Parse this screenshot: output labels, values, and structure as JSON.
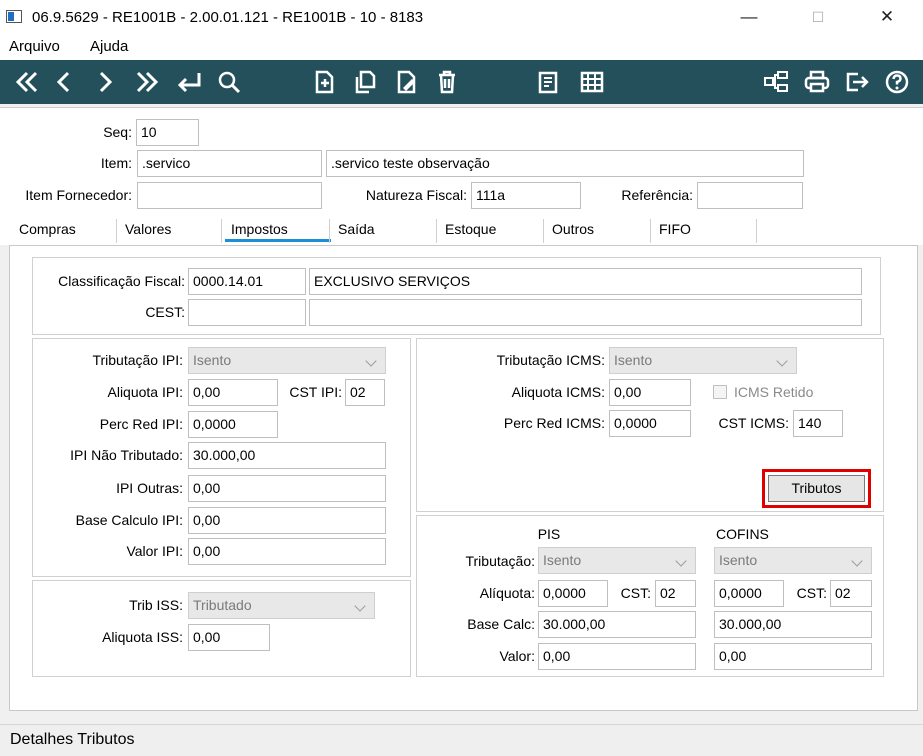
{
  "window": {
    "title": "06.9.5629 - RE1001B - 2.00.01.121 - RE1001B - 10 - 8183",
    "minimize": "—",
    "maximize": "☐",
    "close": "✕"
  },
  "menu": {
    "arquivo": "Arquivo",
    "ajuda": "Ajuda"
  },
  "toolbar": {
    "icons": [
      "first-icon",
      "previous-icon",
      "next-icon",
      "last-icon",
      "return-icon",
      "search-icon",
      "new-document-icon",
      "copy-icon",
      "edit-icon",
      "delete-icon",
      "report-icon",
      "grid-icon",
      "tree-icon",
      "print-icon",
      "exit-icon",
      "help-icon"
    ]
  },
  "header": {
    "seq_label": "Seq:",
    "seq_value": "10",
    "item_label": "Item:",
    "item_code": ".servico",
    "item_desc": ".servico teste observação",
    "item_fornecedor_label": "Item Fornecedor:",
    "item_fornecedor_value": "",
    "natureza_label": "Natureza Fiscal:",
    "natureza_value": "111a",
    "referencia_label": "Referência:",
    "referencia_value": ""
  },
  "tabs": [
    "Compras",
    "Valores",
    "Impostos",
    "Saída",
    "Estoque",
    "Outros",
    "FIFO"
  ],
  "active_tab": "Impostos",
  "accent_color": "#1a8fd6",
  "classificacao": {
    "label": "Classificação Fiscal:",
    "code": "0000.14.01",
    "desc": "EXCLUSIVO SERVIÇOS",
    "cest_label": "CEST:",
    "cest_code": "",
    "cest_desc": ""
  },
  "ipi": {
    "tributacao_label": "Tributação IPI:",
    "tributacao_value": "Isento",
    "aliquota_label": "Aliquota IPI:",
    "aliquota_value": "0,00",
    "cst_label": "CST IPI:",
    "cst_value": "02",
    "perc_red_label": "Perc Red IPI:",
    "perc_red_value": "0,0000",
    "nao_tributado_label": "IPI Não Tributado:",
    "nao_tributado_value": "30.000,00",
    "outras_label": "IPI Outras:",
    "outras_value": "0,00",
    "base_label": "Base Calculo IPI:",
    "base_value": "0,00",
    "valor_label": "Valor IPI:",
    "valor_value": "0,00"
  },
  "iss": {
    "trib_label": "Trib ISS:",
    "trib_value": "Tributado",
    "aliquota_label": "Aliquota ISS:",
    "aliquota_value": "0,00"
  },
  "icms": {
    "tributacao_label": "Tributação ICMS:",
    "tributacao_value": "Isento",
    "aliquota_label": "Aliquota ICMS:",
    "aliquota_value": "0,00",
    "retido_label": "ICMS Retido",
    "perc_red_label": "Perc Red ICMS:",
    "perc_red_value": "0,0000",
    "cst_label": "CST ICMS:",
    "cst_value": "140",
    "tributos_button": "Tributos"
  },
  "pis_cofins": {
    "pis_header": "PIS",
    "cofins_header": "COFINS",
    "tributacao_label": "Tributação:",
    "aliquota_label": "Alíquota:",
    "cst_label": "CST:",
    "base_label": "Base Calc:",
    "valor_label": "Valor:",
    "pis": {
      "tributacao": "Isento",
      "aliquota": "0,0000",
      "cst": "02",
      "base": "30.000,00",
      "valor": "0,00"
    },
    "cofins": {
      "tributacao": "Isento",
      "aliquota": "0,0000",
      "cst": "02",
      "base": "30.000,00",
      "valor": "0,00"
    }
  },
  "status": {
    "text": "Detalhes Tributos"
  }
}
